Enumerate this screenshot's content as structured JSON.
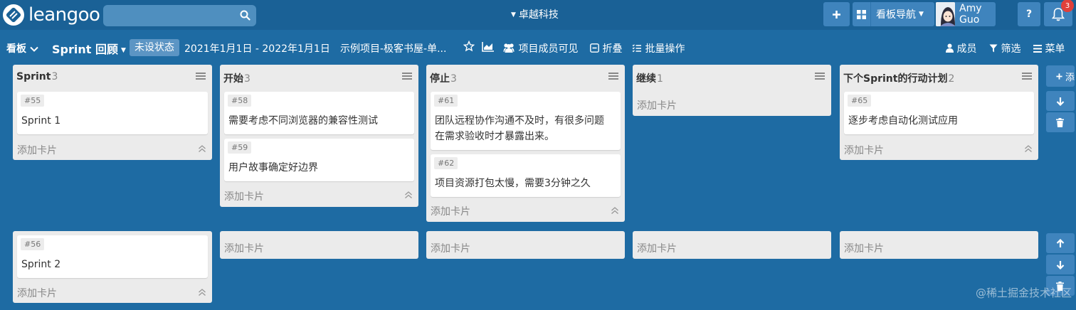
{
  "topbar": {
    "logo_text": "leangoo",
    "search_placeholder": "",
    "org_name": "卓越科技",
    "board_nav_label": "看板导航",
    "user_name": "Amy Guo",
    "help_label": "?",
    "notification_count": "3"
  },
  "board_header": {
    "board_menu_label": "看板",
    "board_name": "Sprint 回顾",
    "status": "未设状态",
    "date_range": "2021年1月1日 - 2022年1月1日",
    "project_name": "示例项目-极客书屋-单...",
    "visibility": "项目成员可见",
    "fold_label": "折叠",
    "batch_label": "批量操作",
    "members_label": "成员",
    "filter_label": "筛选",
    "menu_label": "菜单"
  },
  "lanes": [
    {
      "lists": [
        {
          "title": "Sprint",
          "count": "3",
          "cards": [
            {
              "id": "#55",
              "text": "Sprint 1"
            }
          ],
          "add_label": "添加卡片"
        },
        {
          "title": "开始",
          "count": "3",
          "cards": [
            {
              "id": "#58",
              "text": "需要考虑不同浏览器的兼容性测试"
            },
            {
              "id": "#59",
              "text": "用户故事确定好边界"
            }
          ],
          "add_label": "添加卡片"
        },
        {
          "title": "停止",
          "count": "3",
          "cards": [
            {
              "id": "#61",
              "text": "团队远程协作沟通不及时，有很多问题在需求验收时才暴露出来。"
            },
            {
              "id": "#62",
              "text": "项目资源打包太慢，需要3分钟之久"
            }
          ],
          "add_label": "添加卡片"
        },
        {
          "title": "继续",
          "count": "1",
          "cards": [],
          "add_label": "添加卡片"
        },
        {
          "title": "下个Sprint的行动计划",
          "count": "2",
          "cards": [
            {
              "id": "#65",
              "text": "逐步考虑自动化测试应用"
            }
          ],
          "add_label": "添加卡片"
        }
      ],
      "side_add_label": "添"
    },
    {
      "lists": [
        {
          "cards": [
            {
              "id": "#56",
              "text": "Sprint 2"
            }
          ],
          "add_label": "添加卡片"
        },
        {
          "cards": [],
          "add_label": "添加卡片"
        },
        {
          "cards": [],
          "add_label": "添加卡片"
        },
        {
          "cards": [],
          "add_label": "添加卡片"
        },
        {
          "cards": [],
          "add_label": "添加卡片"
        }
      ]
    }
  ],
  "watermark": "@稀土掘金技术社区",
  "colors": {
    "background": "#1e6ba3",
    "topbar": "#1a6196",
    "button": "#3f84bd",
    "list": "#ebebeb",
    "badge": "#e0403b"
  },
  "icons": [
    "leangoo-logo-icon",
    "search-icon",
    "plus-icon",
    "grid-icon",
    "bell-icon",
    "star-icon",
    "chart-icon",
    "members-icon",
    "fold-icon",
    "batch-icon",
    "user-icon",
    "filter-icon",
    "menu-icon",
    "hamburger-icon",
    "collapse-up-icon",
    "arrow-up-icon",
    "arrow-down-icon",
    "trash-icon"
  ]
}
